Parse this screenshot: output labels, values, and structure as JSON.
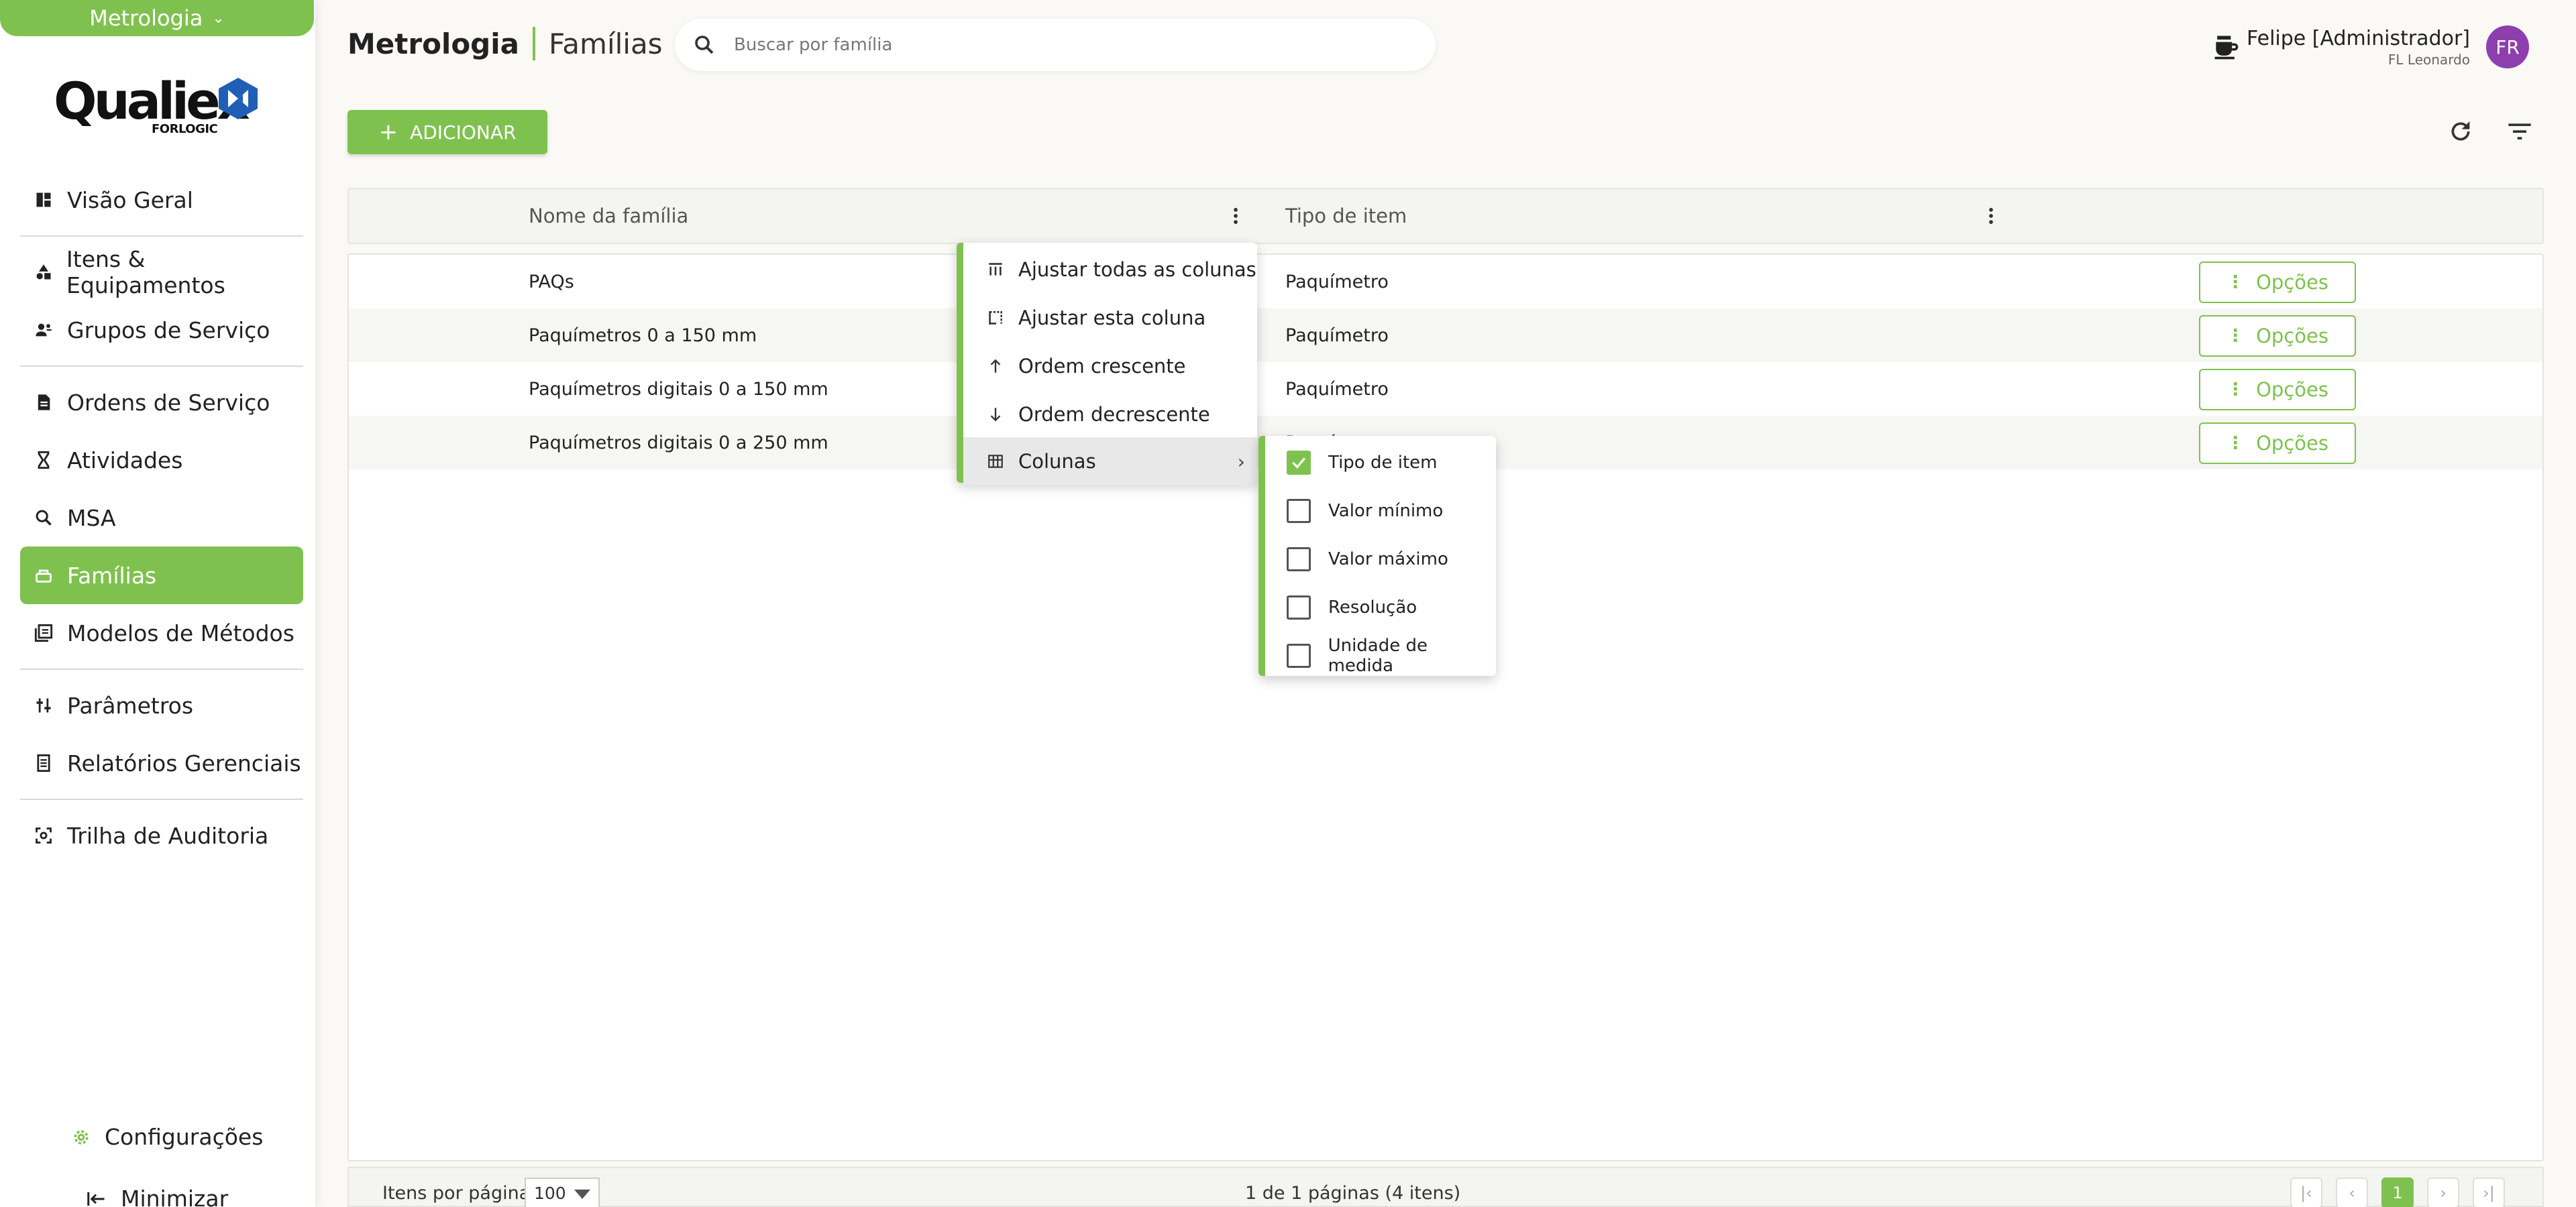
{
  "app": {
    "module": "Metrologia",
    "logo_text": "Qualiex",
    "logo_sub": "FORLOGIC",
    "accent": "#7fc14f",
    "avatar_color": "#8e3fae"
  },
  "sidebar": {
    "items": [
      {
        "label": "Visão Geral",
        "icon": "dashboard-icon"
      },
      {
        "label": "Itens & Equipamentos",
        "icon": "shapes-icon"
      },
      {
        "label": "Grupos de Serviço",
        "icon": "group-icon"
      },
      {
        "label": "Ordens de Serviço",
        "icon": "document-icon"
      },
      {
        "label": "Atividades",
        "icon": "hourglass-icon"
      },
      {
        "label": "MSA",
        "icon": "zoom-icon"
      },
      {
        "label": "Famílias",
        "icon": "family-icon"
      },
      {
        "label": "Modelos de Métodos",
        "icon": "library-icon"
      },
      {
        "label": "Parâmetros",
        "icon": "sliders-icon"
      },
      {
        "label": "Relatórios Gerenciais",
        "icon": "report-icon"
      },
      {
        "label": "Trilha de Auditoria",
        "icon": "audit-icon"
      }
    ],
    "active": "Famílias",
    "settings_label": "Configurações",
    "minimize_label": "Minimizar"
  },
  "header": {
    "module": "Metrologia",
    "page": "Famílias",
    "search_placeholder": "Buscar por família",
    "user_name": "Felipe [Administrador]",
    "company": "FL Leonardo",
    "avatar_initials": "FR"
  },
  "toolbar": {
    "add_label": "ADICIONAR"
  },
  "grid": {
    "columns": [
      "Nome da família",
      "Tipo de item"
    ],
    "rows": [
      {
        "name": "PAQs",
        "type": "Paquímetro"
      },
      {
        "name": "Paquímetros 0 a 150 mm",
        "type": "Paquímetro"
      },
      {
        "name": "Paquímetros digitais 0 a 150 mm",
        "type": "Paquímetro"
      },
      {
        "name": "Paquímetros digitais 0 a 250 mm",
        "type": "Paquímetro"
      }
    ],
    "options_label": "Opções"
  },
  "footer": {
    "items_per_page_label": "Itens por página",
    "items_per_page": "100",
    "page_info": "1 de 1 páginas (4 itens)",
    "current_page": "1"
  },
  "column_menu": {
    "items": [
      "Ajustar todas as colunas",
      "Ajustar esta coluna",
      "Ordem crescente",
      "Ordem decrescente",
      "Colunas"
    ],
    "columns_submenu": [
      {
        "label": "Tipo de item",
        "checked": true
      },
      {
        "label": "Valor mínimo",
        "checked": false
      },
      {
        "label": "Valor máximo",
        "checked": false
      },
      {
        "label": "Resolução",
        "checked": false
      },
      {
        "label": "Unidade de medida",
        "checked": false
      }
    ]
  }
}
